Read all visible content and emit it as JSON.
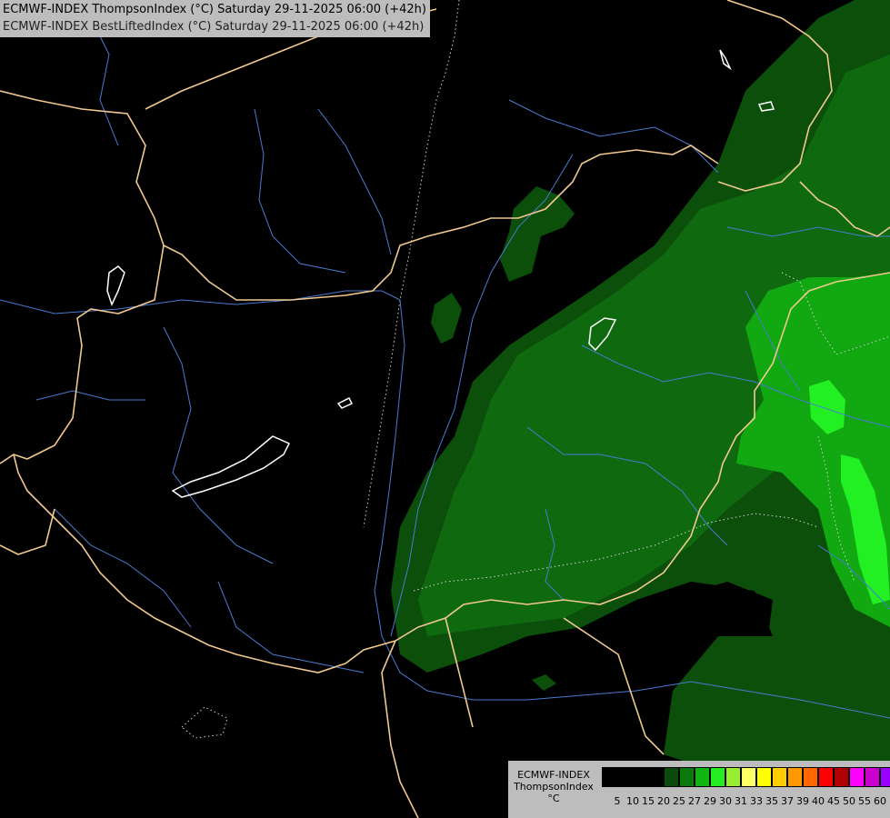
{
  "title": {
    "line1": "ECMWF-INDEX ThompsonIndex (°C) Saturday 29-11-2025 06:00 (+42h)",
    "line2": "ECMWF-INDEX BestLiftedIndex (°C) Saturday 29-11-2025 06:00 (+42h)"
  },
  "legend": {
    "model": "ECMWF-INDEX",
    "parameter": "ThompsonIndex",
    "unit": "°C",
    "ticks": [
      "5",
      "10",
      "15",
      "20",
      "25",
      "27",
      "29",
      "30",
      "31",
      "33",
      "35",
      "37",
      "39",
      "40",
      "45",
      "50",
      "55",
      "60"
    ],
    "colors": [
      "#000000",
      "#000000",
      "#000000",
      "#000000",
      "#0a4a0a",
      "#0b7a0b",
      "#0fb60f",
      "#22ee22",
      "#99ee33",
      "#ffff66",
      "#ffff00",
      "#ffcc00",
      "#ff9900",
      "#ff6600",
      "#ff0000",
      "#b00000",
      "#ff00ff",
      "#cc00cc",
      "#9900ff",
      "#6600ff",
      "#0000ff"
    ]
  },
  "colors": {
    "background": "#000000",
    "border": "#f0c890",
    "river": "#4a7bd0",
    "lake_outline": "#ffffff",
    "green_dark": "#0b4f0b",
    "green_mid": "#137a13",
    "green_light": "#10b010",
    "green_bright": "#1ee81e"
  }
}
